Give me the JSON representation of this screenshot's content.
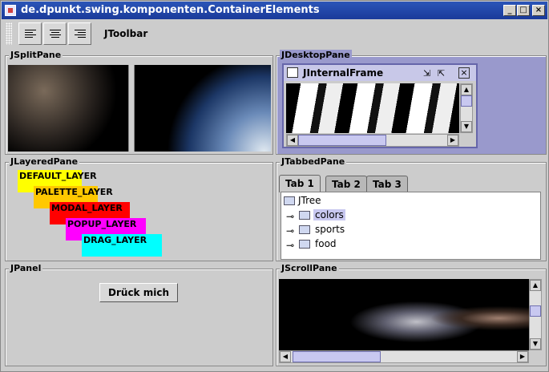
{
  "window": {
    "title": "de.dpunkt.swing.komponenten.ContainerElements"
  },
  "toolbar": {
    "label": "JToolbar"
  },
  "panels": {
    "splitpane": "JSplitPane",
    "desktoppane": "JDesktopPane",
    "layeredpane": "JLayeredPane",
    "tabbedpane": "JTabbedPane",
    "panel": "JPanel",
    "scrollpane": "JScrollPane"
  },
  "internal_frame": {
    "title": "JInternalFrame"
  },
  "layers": [
    "DEFAULT_LAYER",
    "PALETTE_LAYER",
    "MODAL_LAYER",
    "POPUP_LAYER",
    "DRAG_LAYER"
  ],
  "layer_colors": [
    "#ffff00",
    "#ffc800",
    "#ff0000",
    "#ff00ff",
    "#00ffff"
  ],
  "tabs": [
    "Tab 1",
    "Tab 2",
    "Tab 3"
  ],
  "tree": {
    "root": "JTree",
    "children": [
      "colors",
      "sports",
      "food"
    ]
  },
  "button": {
    "label": "Drück mich"
  }
}
